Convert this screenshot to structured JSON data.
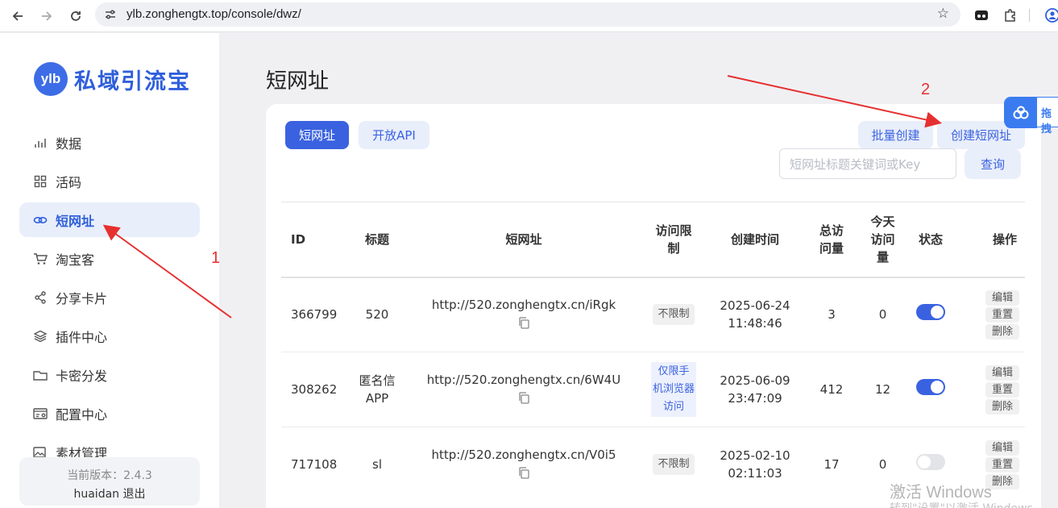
{
  "browser": {
    "url": "ylb.zonghengtx.top/console/dwz/"
  },
  "sidebar": {
    "logo_badge": "ylb",
    "logo_text": "私域引流宝",
    "items": [
      {
        "label": "数据",
        "icon": "chart-icon"
      },
      {
        "label": "活码",
        "icon": "grid-icon"
      },
      {
        "label": "短网址",
        "icon": "link-icon",
        "active": true
      },
      {
        "label": "淘宝客",
        "icon": "cart-icon"
      },
      {
        "label": "分享卡片",
        "icon": "share-icon"
      },
      {
        "label": "插件中心",
        "icon": "layers-icon"
      },
      {
        "label": "卡密分发",
        "icon": "card-icon"
      },
      {
        "label": "配置中心",
        "icon": "config-icon"
      },
      {
        "label": "素材管理",
        "icon": "media-icon"
      }
    ],
    "version": "当前版本：2.4.3",
    "username": "huaidan",
    "logout": "退出"
  },
  "main": {
    "title": "短网址",
    "tabs": [
      "短网址",
      "开放API"
    ],
    "batch_create": "批量创建",
    "create_short_url": "创建短网址",
    "search_placeholder": "短网址标题关键词或Key",
    "search_button": "查询",
    "columns": [
      "ID",
      "标题",
      "短网址",
      "访问限制",
      "创建时间",
      "总访问量",
      "今天访问量",
      "状态",
      "操作"
    ],
    "header_lines": {
      "limit": [
        "访问限",
        "制"
      ],
      "total": [
        "总访",
        "问量"
      ],
      "today": [
        "今天",
        "访问",
        "量"
      ]
    },
    "rows": [
      {
        "id": "366799",
        "title": "520",
        "title2": "",
        "url": "http://520.zonghengtx.cn/iRgk",
        "limit": "不限制",
        "limit_style": "gray",
        "date": "2025-06-24",
        "time": "11:48:46",
        "total": "3",
        "today": "0",
        "enabled": true
      },
      {
        "id": "308262",
        "title": "匿名信",
        "title2": "APP",
        "url": "http://520.zonghengtx.cn/6W4U",
        "limit": "仅限手机浏览器访问",
        "limit_lines": [
          "仅限手",
          "机浏览器",
          "访问"
        ],
        "limit_style": "blue",
        "date": "2025-06-09",
        "time": "23:47:09",
        "total": "412",
        "today": "12",
        "enabled": true
      },
      {
        "id": "717108",
        "title": "sl",
        "title2": "",
        "url": "http://520.zonghengtx.cn/V0i5",
        "limit": "不限制",
        "limit_style": "gray",
        "date": "2025-02-10",
        "time": "02:11:03",
        "total": "17",
        "today": "0",
        "enabled": false
      }
    ],
    "actions": [
      "编辑",
      "重置",
      "删除"
    ]
  },
  "float_tab": {
    "label": "拖拽"
  },
  "annotations": {
    "one": "1",
    "two": "2",
    "color": "#e63030"
  },
  "watermark": {
    "line1": "激活 Windows",
    "line2": "转到\"设置\"以激活 Windows。"
  }
}
